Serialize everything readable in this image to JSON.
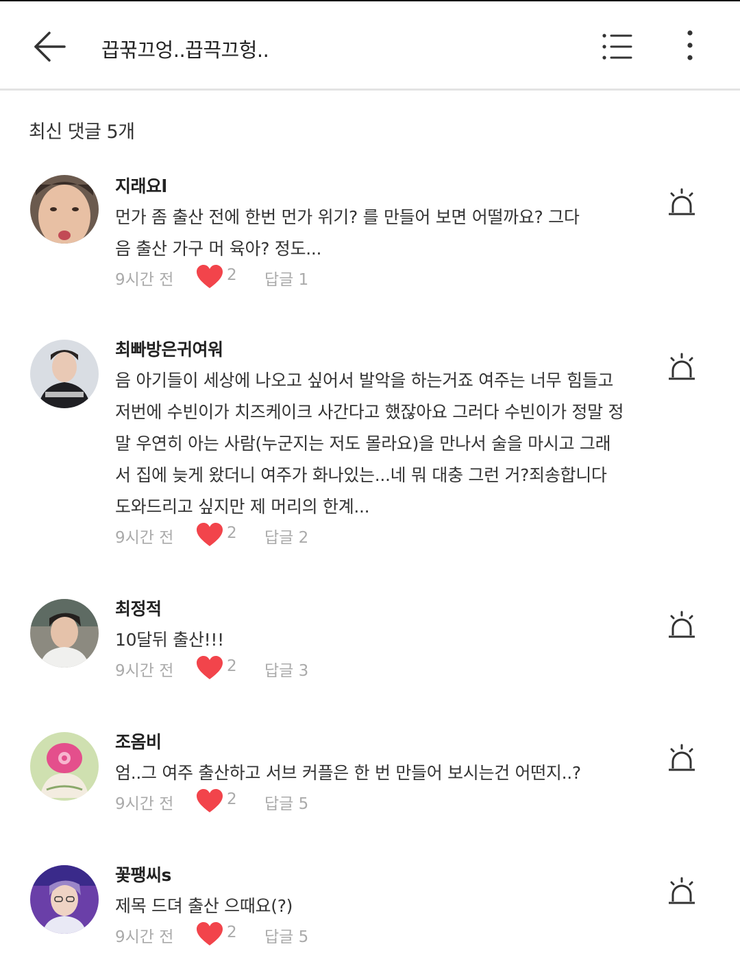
{
  "header": {
    "title": "끕꾺끄엉..끕끅끄헝.."
  },
  "section": {
    "title": "최신 댓글 5개"
  },
  "comments": [
    {
      "author": "지래요l",
      "text": "먼가 좀 출산 전에 한번 먼가 위기? 를 만들어 보면 어떨까요? 그다음 출산 가구 머 육아? 정도...",
      "time": "9시간 전",
      "likes": "2",
      "reply": "답글 1"
    },
    {
      "author": "최빠방은귀여워",
      "text": "음 아기들이 세상에 나오고 싶어서 발악을 하는거죠 여주는 너무 힘들고 저번에 수빈이가 치즈케이크 사간다고 했잖아요 그러다 수빈이가 정말 정말 우연히 아는 사람(누군지는 저도 몰라요)을 만나서 술을 마시고 그래서 집에 늦게 왔더니 여주가 화나있는...네 뭐 대충 그런 거?죄송합니다 도와드리고 싶지만 제 머리의 한계...",
      "time": "9시간 전",
      "likes": "2",
      "reply": "답글 2"
    },
    {
      "author": "최정적",
      "text": "10달뒤 출산!!!",
      "time": "9시간 전",
      "likes": "2",
      "reply": "답글 3"
    },
    {
      "author": "조옴비",
      "text": "엄..그 여주 출산하고 서브 커플은 한 번 만들어 보시는건 어떤지..?",
      "time": "9시간 전",
      "likes": "2",
      "reply": "답글 5"
    },
    {
      "author": "꽃팽씨s",
      "text": "제목 드뎌 출산 으때요(?)",
      "time": "9시간 전",
      "likes": "2",
      "reply": "답글 5"
    }
  ],
  "icons": {
    "back": "arrow-left-icon",
    "list": "list-icon",
    "more": "more-vertical-icon",
    "like": "heart-icon",
    "report": "siren-icon"
  },
  "colors": {
    "heart": "#f2444b",
    "meta_text": "#aaaaaa",
    "divider": "#e3e3e3"
  }
}
